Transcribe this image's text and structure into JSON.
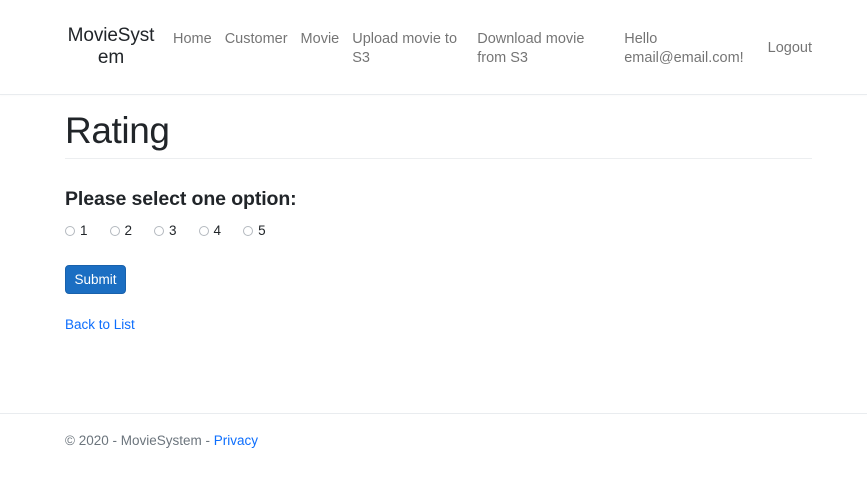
{
  "navbar": {
    "brand": "MovieSystem",
    "links": [
      {
        "label": "Home",
        "name": "nav-link-home"
      },
      {
        "label": "Customer",
        "name": "nav-link-customer"
      },
      {
        "label": "Movie",
        "name": "nav-link-movie"
      },
      {
        "label": "Upload movie to S3",
        "name": "nav-link-upload-movie-to-s3"
      },
      {
        "label": "Download movie from S3",
        "name": "nav-link-download-movie-from-s3"
      },
      {
        "label": "Hello email@email.com!",
        "name": "nav-link-user-greeting"
      }
    ],
    "logout_label": "Logout"
  },
  "main": {
    "page_title": "Rating",
    "form_heading": "Please select one option:",
    "options": [
      {
        "value": "1",
        "checked": false
      },
      {
        "value": "2",
        "checked": false
      },
      {
        "value": "3",
        "checked": false
      },
      {
        "value": "4",
        "checked": false
      },
      {
        "value": "5",
        "checked": false
      }
    ],
    "submit_label": "Submit",
    "back_link_label": "Back to List"
  },
  "footer": {
    "copyright": "© 2020 - MovieSystem - ",
    "privacy_label": "Privacy"
  },
  "colors": {
    "primary": "#1b6ec2",
    "link": "#0d6efd",
    "text": "#212529",
    "muted": "#6c757d",
    "border": "#e9ecef"
  }
}
